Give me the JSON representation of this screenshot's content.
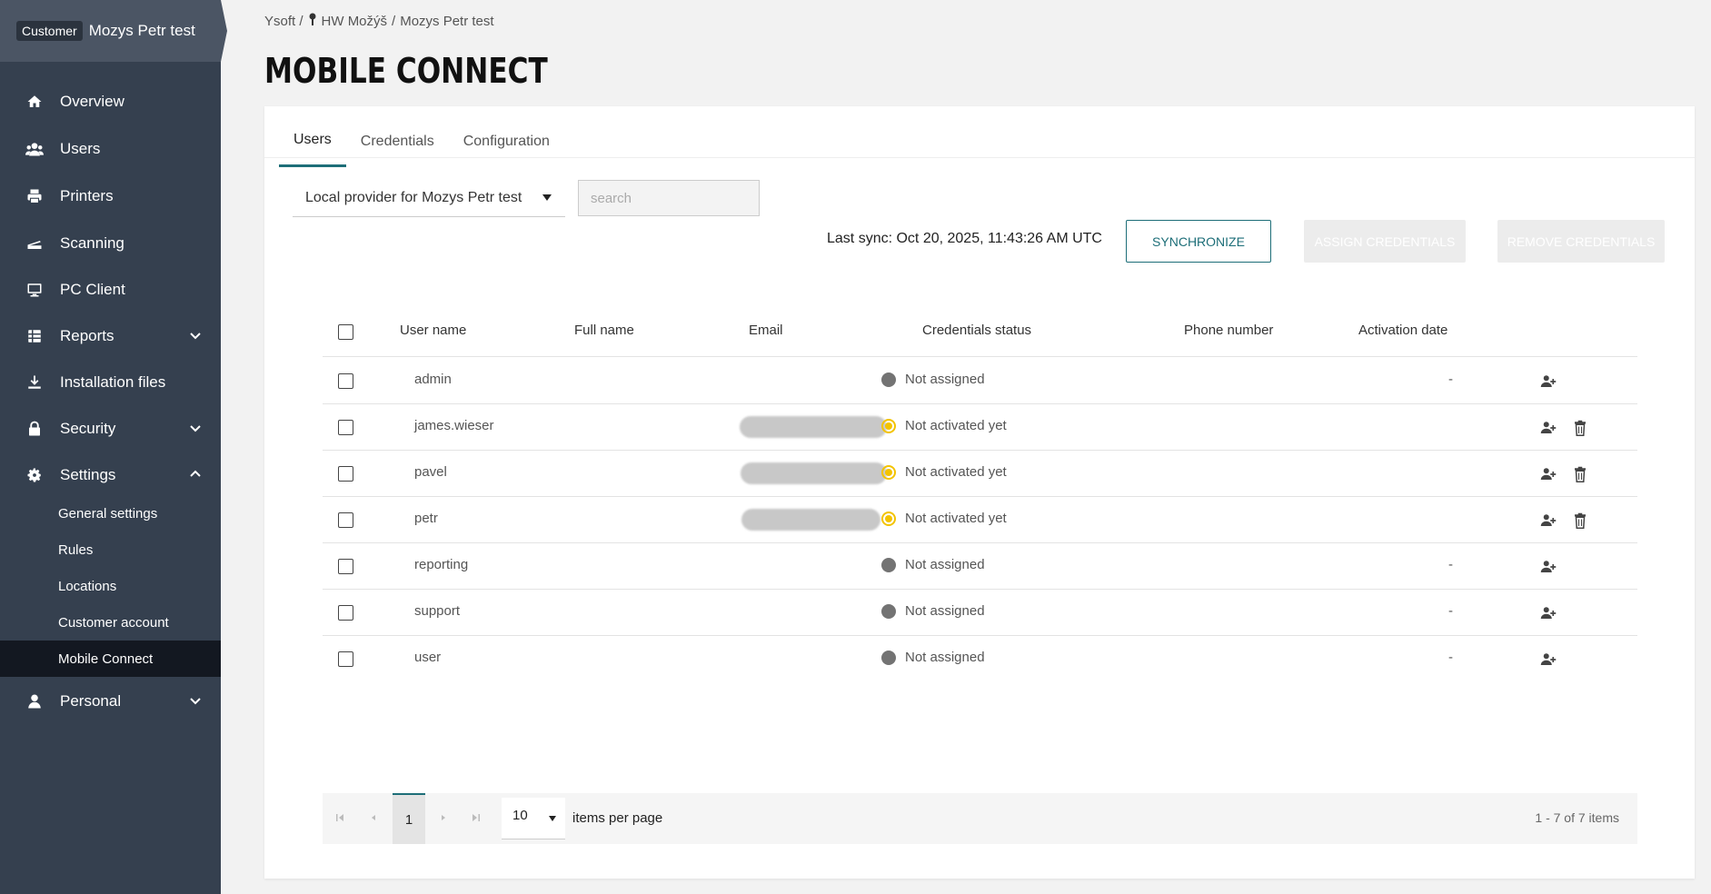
{
  "customer": {
    "badge": "Customer",
    "name": "Mozys Petr test"
  },
  "sidebar": {
    "items": [
      {
        "label": "Overview",
        "icon": "home-icon"
      },
      {
        "label": "Users",
        "icon": "users-icon"
      },
      {
        "label": "Printers",
        "icon": "printer-icon"
      },
      {
        "label": "Scanning",
        "icon": "scanner-icon"
      },
      {
        "label": "PC Client",
        "icon": "monitor-icon"
      },
      {
        "label": "Reports",
        "icon": "reports-icon"
      },
      {
        "label": "Installation files",
        "icon": "download-icon"
      },
      {
        "label": "Security",
        "icon": "lock-icon"
      },
      {
        "label": "Settings",
        "icon": "gear-icon"
      },
      {
        "label": "Personal",
        "icon": "person-icon"
      }
    ],
    "settings_sub": [
      "General settings",
      "Rules",
      "Locations",
      "Customer account",
      "Mobile Connect"
    ]
  },
  "breadcrumb": {
    "root": "Ysoft /",
    "location": "HW Možýš",
    "sep": "/",
    "current": "Mozys Petr test"
  },
  "page_title": "MOBILE CONNECT",
  "tabs": [
    "Users",
    "Credentials",
    "Configuration"
  ],
  "provider": "Local provider for Mozys Petr test",
  "search": {
    "placeholder": "search",
    "value": ""
  },
  "last_sync": "Last sync: Oct 20, 2025, 11:43:26 AM UTC",
  "buttons": {
    "synchronize": "SYNCHRONIZE",
    "assign": "ASSIGN CREDENTIALS",
    "remove": "REMOVE CREDENTIALS"
  },
  "table": {
    "headers": [
      "User name",
      "Full name",
      "Email",
      "Credentials status",
      "Phone number",
      "Activation date"
    ],
    "rows": [
      {
        "user": "admin",
        "status": "Not assigned",
        "phone": "-"
      },
      {
        "user": "james.wieser",
        "status": "Not activated yet",
        "phone": ""
      },
      {
        "user": "pavel",
        "status": "Not activated yet",
        "phone": ""
      },
      {
        "user": "petr",
        "status": "Not activated yet",
        "phone": ""
      },
      {
        "user": "reporting",
        "status": "Not assigned",
        "phone": "-"
      },
      {
        "user": "support",
        "status": "Not assigned",
        "phone": "-"
      },
      {
        "user": "user",
        "status": "Not assigned",
        "phone": "-"
      }
    ]
  },
  "pager": {
    "page": "1",
    "page_size": "10",
    "per_page_label": "items per page",
    "info": "1 - 7 of 7 items"
  },
  "colors": {
    "sidebar": "#35404f",
    "accent": "#1d6e78",
    "pending": "#f3c300",
    "inactive": "#737373"
  }
}
